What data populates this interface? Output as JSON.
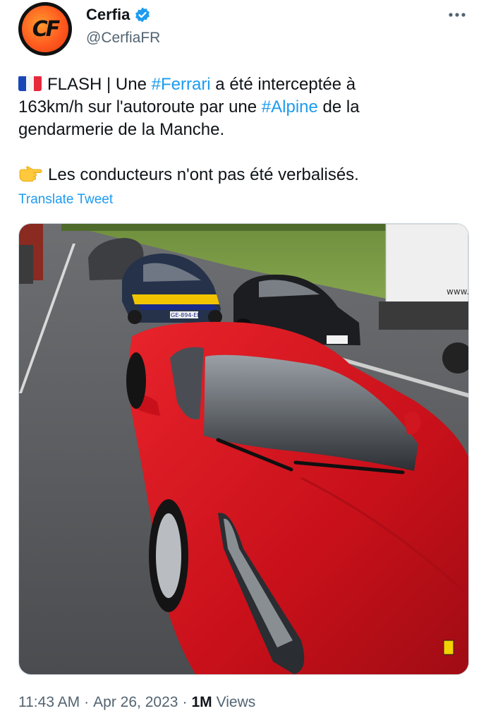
{
  "author": {
    "avatar_text": "CF",
    "display_name": "Cerfia",
    "handle": "@CerfiaFR",
    "verified": true
  },
  "tweet": {
    "line1_pre": "FLASH | Une ",
    "line1_tag": "#Ferrari",
    "line1_post": " a été interceptée à",
    "line2_pre": "163km/h sur l'autoroute par une ",
    "line2_tag": "#Alpine",
    "line2_post": " de la",
    "line3": "gendarmerie de la Manche.",
    "line4": "Les conducteurs n'ont pas été verbalisés.",
    "flag_emoji": "france-flag",
    "pointer_emoji": "pointing-right-hand"
  },
  "translate_label": "Translate Tweet",
  "media": {
    "plate_text": "GE-894-ER",
    "truck_text": "www."
  },
  "meta": {
    "time": "11:43 AM",
    "sep1": "·",
    "date": "Apr 26, 2023",
    "sep2": "·",
    "views_count": "1M",
    "views_label": "Views"
  },
  "colors": {
    "accent": "#1d9bf0",
    "text": "#0f1419",
    "muted": "#536471",
    "ferrari_red": "#d8141c"
  }
}
